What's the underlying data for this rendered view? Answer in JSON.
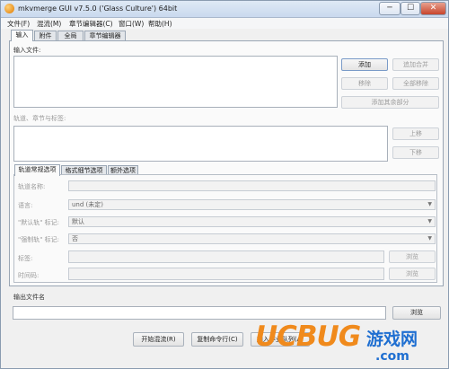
{
  "window": {
    "title": "mkvmerge GUI v7.5.0 ('Glass Culture') 64bit",
    "min_glyph": "─",
    "max_glyph": "☐",
    "close_glyph": "✕"
  },
  "menu": {
    "items": [
      "文件(F)",
      "混流(M)",
      "章节编辑器(C)",
      "窗口(W)",
      "帮助(H)"
    ]
  },
  "tabs": [
    "输入",
    "附件",
    "全局",
    "章节编辑器"
  ],
  "input": {
    "files_label": "输入文件:",
    "buttons": [
      "添加",
      "追加合并",
      "移除",
      "全部移除",
      "添加其余部分"
    ],
    "tracks_label": "轨道、章节与标签:",
    "move_up": "上移",
    "move_down": "下移"
  },
  "subtabs": [
    "轨道常规选项",
    "格式细节选项",
    "额外选项"
  ],
  "track_options": {
    "name_label": "轨道名称:",
    "language_label": "语言:",
    "language_value": "und (未定)",
    "default_label": "\"默认轨\" 标记:",
    "default_value": "默认",
    "forced_label": "\"强制轨\" 标记:",
    "forced_value": "否",
    "tags_label": "标签:",
    "timecodes_label": "时间码:",
    "browse": "浏览"
  },
  "output": {
    "label": "输出文件名",
    "browse": "浏览"
  },
  "bottom_buttons": [
    "开始混流(R)",
    "复制命令行(C)",
    "加入作业队列(A)"
  ],
  "watermark": {
    "ucbug": "UCBUG",
    "cn": "游戏网",
    "com": ".com"
  },
  "colors": {
    "watermark_orange": "#f08a1c",
    "watermark_blue": "#1f6fd1"
  }
}
